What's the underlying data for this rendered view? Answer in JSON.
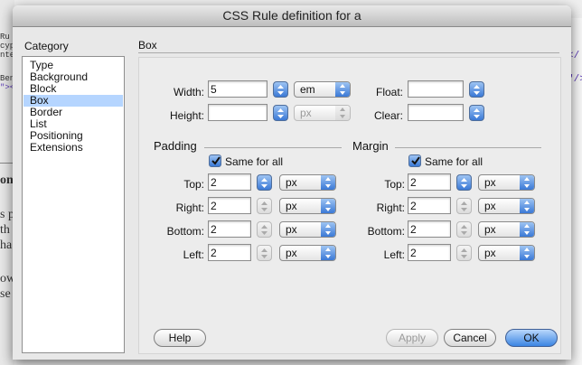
{
  "window": {
    "title": "CSS Rule definition for a"
  },
  "category": {
    "heading": "Category",
    "items": [
      "Type",
      "Background",
      "Block",
      "Box",
      "Border",
      "List",
      "Positioning",
      "Extensions"
    ],
    "selected": "Box"
  },
  "panel_title": "Box",
  "dimensions": {
    "width_label": "Width:",
    "width_value": "5",
    "width_unit": "em",
    "height_label": "Height:",
    "height_value": "",
    "height_unit": "px",
    "float_label": "Float:",
    "float_value": "",
    "clear_label": "Clear:",
    "clear_value": ""
  },
  "padding": {
    "title": "Padding",
    "same_for_all_label": "Same for all",
    "same_for_all_checked": true,
    "rows": [
      {
        "label": "Top:",
        "value": "2",
        "unit": "px"
      },
      {
        "label": "Right:",
        "value": "2",
        "unit": "px"
      },
      {
        "label": "Bottom:",
        "value": "2",
        "unit": "px"
      },
      {
        "label": "Left:",
        "value": "2",
        "unit": "px"
      }
    ]
  },
  "margin": {
    "title": "Margin",
    "same_for_all_label": "Same for all",
    "same_for_all_checked": true,
    "rows": [
      {
        "label": "Top:",
        "value": "2",
        "unit": "px"
      },
      {
        "label": "Right:",
        "value": "2",
        "unit": "px"
      },
      {
        "label": "Bottom:",
        "value": "2",
        "unit": "px"
      },
      {
        "label": "Left:",
        "value": "2",
        "unit": "px"
      }
    ]
  },
  "buttons": {
    "help": "Help",
    "apply": "Apply",
    "cancel": "Cancel",
    "ok": "OK"
  },
  "background_app": {
    "left_fragments": [
      "Ru",
      "cyp",
      "nte",
      "Ben",
      "\"><"
    ],
    "right_fragments": [
      "</",
      "\"/>"
    ],
    "serif_fragments": [
      "on",
      "s p",
      "th",
      "ha",
      "ow",
      "se"
    ]
  },
  "colors": {
    "accent": "#3a79d6",
    "selection": "#b5d5ff"
  }
}
